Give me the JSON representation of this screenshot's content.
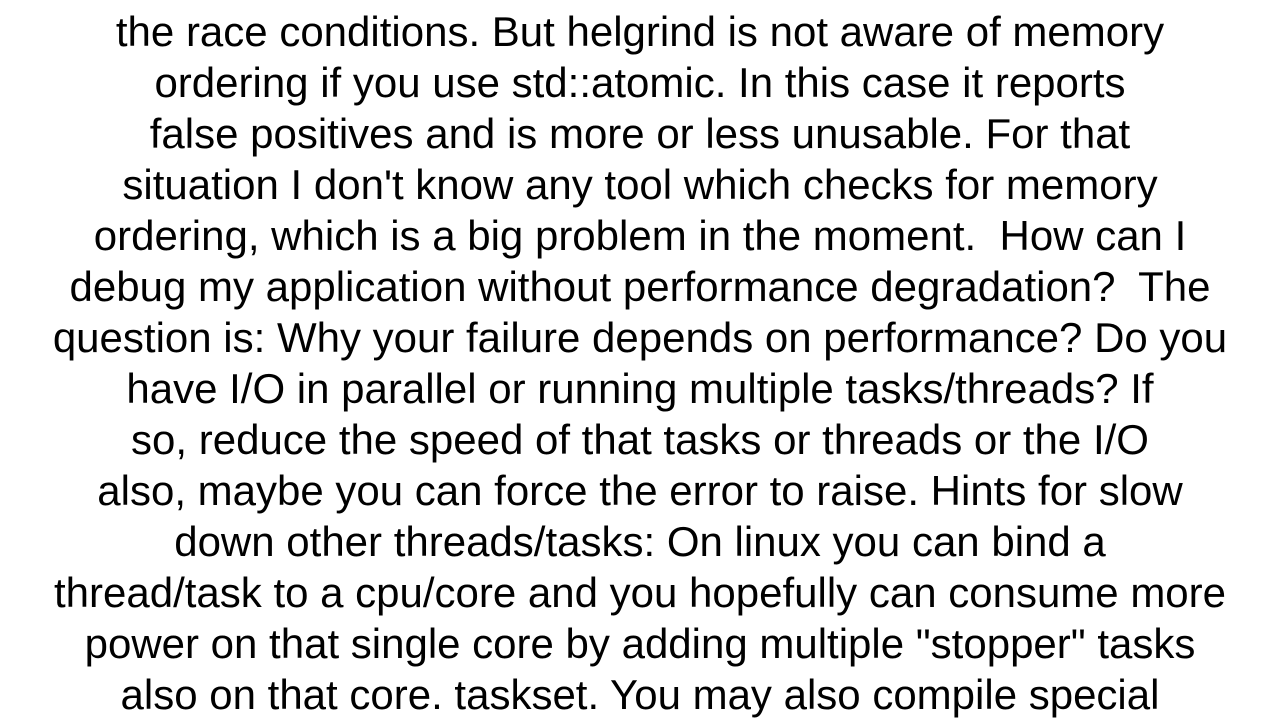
{
  "lines": [
    "the race conditions. But helgrind is not aware of memory",
    "ordering if you use std::atomic. In this case it reports",
    "false positives and is more or less unusable. For that",
    "situation I don't know any tool which checks for memory",
    "ordering, which is a big problem in the moment.  How can I",
    "debug my application without performance degradation?  The",
    "question is: Why your failure depends on performance? Do you",
    "have I/O in parallel or running multiple tasks/threads? If",
    "so, reduce the speed of that tasks or threads or the I/O",
    "also, maybe you can force the error to raise. Hints for slow",
    "down other threads/tasks: On linux you can bind a",
    "thread/task to a cpu/core and you hopefully can consume more",
    "power on that single core by adding multiple \"stopper\" tasks",
    "also on that core. taskset. You may also compile special"
  ]
}
